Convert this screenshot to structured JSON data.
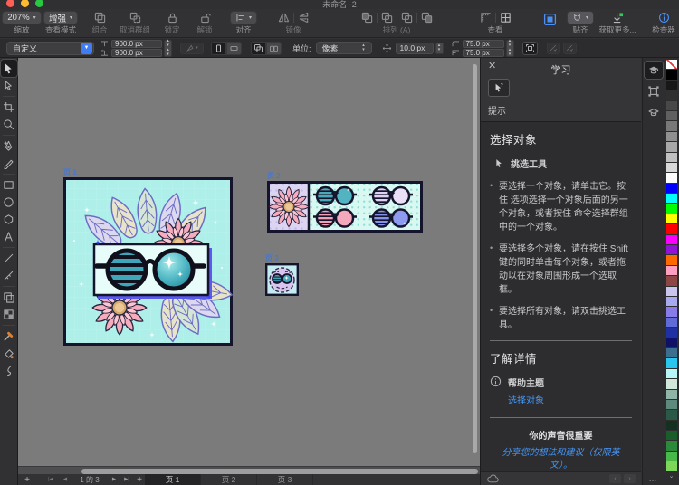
{
  "window": {
    "title": "未命名 -2"
  },
  "toolbar": {
    "zoom": {
      "value": "207%",
      "label": "缩放",
      "chevron": "▾"
    },
    "view_mode": {
      "value": "增强",
      "label": "查看模式",
      "chevron": "▾"
    },
    "group_label": "组合",
    "ungroup_label": "取消群组",
    "lock_label": "锁定",
    "unlock_label": "解锁",
    "align_label": "对齐",
    "mirror_label": "镜像",
    "arrange_label": "排列 (A)",
    "view_label": "查看",
    "snap_label": "贴齐",
    "get_more_label": "获取更多...",
    "inspector_label": "检查器"
  },
  "context_bar": {
    "preset_value": "自定义",
    "width_value": "900.0 px",
    "height_value": "900.0 px",
    "units_label": "单位:",
    "units_value": "像素",
    "spacing_value": "10.0 px",
    "corner_width_value": "75.0 px",
    "corner_height_value": "75.0 px"
  },
  "canvas": {
    "page_labels": [
      "页 1",
      "页 2",
      "页 3"
    ]
  },
  "bottom_bar": {
    "add_page": "+",
    "nav_first": "|◀",
    "nav_prev": "◀",
    "pager_text": "1 的 3",
    "nav_next": "▶",
    "nav_last": "▶|",
    "add_page_2": "+",
    "tabs": [
      "页 1",
      "页 2",
      "页 3"
    ]
  },
  "learn_panel": {
    "title": "学习",
    "close": "✕",
    "tips_label": "提示",
    "section_title": "选择对象",
    "tool_name": "挑选工具",
    "bullet_marker": "•",
    "bullets": [
      "要选择一个对象，请单击它。按住 选项选择一个对象后面的另一个对象，或者按住 命令选择群组中的一个对象。",
      "要选择多个对象，请在按住 Shift 键的同时单击每个对象，或者拖动以在对象周围形成一个选取框。",
      "要选择所有对象，请双击挑选工具。"
    ],
    "learn_more_title": "了解详情",
    "help_topic_label": "帮助主题",
    "help_link": "选择对象",
    "feedback_title": "你的声音很重要",
    "feedback_link": "分享您的想法和建议（仅限英文）。",
    "footer_more": "…",
    "swatch_more_glyph": "⌄"
  },
  "swatches": {
    "colors": [
      "none",
      "#000000",
      "#181818",
      "#303030",
      "#484848",
      "#606060",
      "#787878",
      "#909090",
      "#a8a8a8",
      "#c0c0c0",
      "#d8d8d8",
      "#ffffff",
      "#0000ff",
      "#00ffff",
      "#00ff00",
      "#ffff00",
      "#ff0000",
      "#ff00ff",
      "#9013d6",
      "#ff6a00",
      "#ff9fbf",
      "#8c4646",
      "#c9c5ee",
      "#a8aaf0",
      "#8a7ce8",
      "#5f6cd8",
      "#1f30a2",
      "#0f1166",
      "#3c6e8f",
      "#29c5ef",
      "#b5f7f7",
      "#cfe8da",
      "#8fb5a8",
      "#5d8a7c",
      "#2b5948",
      "#133021",
      "#1b5c2a",
      "#2b8a3a",
      "#49b84a",
      "#7ed659"
    ]
  },
  "colors": {
    "traffic_red": "#ff5f57",
    "traffic_yellow": "#febc2e",
    "traffic_green": "#28c840",
    "accent_blue": "#3f7df6",
    "link_blue": "#4597f7",
    "get_more_green": "#34c759",
    "canvas_gray": "#7b7b7b",
    "artboard1_bg": "#aef0e9",
    "banner_blue": "#5a5af0",
    "flower_pink": "#f7abbe",
    "lens_teal": "#3fa6ba"
  },
  "icons": {
    "left_tools": [
      "move-tool",
      "node-tool",
      "crop-tool",
      "zoom-tool",
      "pen-tool",
      "pencil-tool",
      "rectangle-tool",
      "ellipse-tool",
      "polygon-tool",
      "text-tool",
      "line-tool",
      "knife-tool",
      "frame-tool",
      "transparency-tool",
      "color-picker-tool",
      "fill-tool",
      "vector-brush-tool"
    ],
    "right_strip": [
      "learn-panel-icon",
      "transform-panel-icon",
      "education-icon"
    ]
  }
}
